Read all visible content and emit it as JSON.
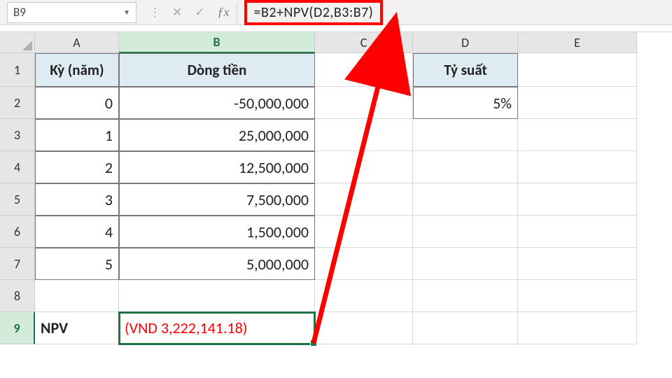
{
  "nameBox": "B9",
  "formula": "=B2+NPV(D2,B3:B7)",
  "columns": [
    "A",
    "B",
    "C",
    "D",
    "E"
  ],
  "rowLabels": [
    "1",
    "2",
    "3",
    "4",
    "5",
    "6",
    "7",
    "8",
    "9"
  ],
  "headers": {
    "A": "Kỳ (năm)",
    "B": "Dòng tiền",
    "D": "Tỷ suất"
  },
  "data": {
    "r2": {
      "A": "0",
      "B": "-50,000,000",
      "D": "5%"
    },
    "r3": {
      "A": "1",
      "B": "25,000,000"
    },
    "r4": {
      "A": "2",
      "B": "12,500,000"
    },
    "r5": {
      "A": "3",
      "B": "7,500,000"
    },
    "r6": {
      "A": "4",
      "B": "1,500,000"
    },
    "r7": {
      "A": "5",
      "B": "5,000,000"
    }
  },
  "result": {
    "label": "NPV",
    "value": "(VND 3,222,141.18)"
  },
  "chart_data": {
    "type": "table",
    "title": "NPV calculation",
    "columns": [
      "Kỳ (năm)",
      "Dòng tiền"
    ],
    "rows": [
      [
        0,
        -50000000
      ],
      [
        1,
        25000000
      ],
      [
        2,
        12500000
      ],
      [
        3,
        7500000
      ],
      [
        4,
        1500000
      ],
      [
        5,
        5000000
      ]
    ],
    "rate_label": "Tỷ suất",
    "rate": 0.05,
    "npv_label": "NPV",
    "npv_value": -3222141.18,
    "formula": "=B2+NPV(D2,B3:B7)"
  }
}
